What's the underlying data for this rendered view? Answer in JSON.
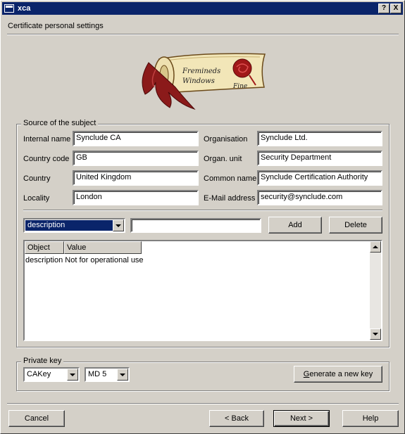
{
  "window": {
    "title": "xca"
  },
  "title_buttons": {
    "help": "?",
    "close": "X"
  },
  "page": {
    "subtitle": "Certificate personal settings"
  },
  "logo": {
    "line1": "Fremineds",
    "line2": "Windows",
    "line3": "Fine"
  },
  "subject": {
    "legend": "Source of the subject",
    "internal_name": {
      "label": "Internal name",
      "value": "Synclude CA"
    },
    "country_code": {
      "label": "Country code",
      "value": "GB"
    },
    "country": {
      "label": "Country",
      "value": "United Kingdom"
    },
    "locality": {
      "label": "Locality",
      "value": "London"
    },
    "organisation": {
      "label": "Organisation",
      "value": "Synclude Ltd."
    },
    "organ_unit": {
      "label": "Organ. unit",
      "value": "Security Department"
    },
    "common_name": {
      "label": "Common name",
      "value": "Synclude Certification Authority"
    },
    "email": {
      "label": "E-Mail address",
      "value": "security@synclude.com"
    }
  },
  "attr": {
    "selected": "description",
    "value": "",
    "add": "Add",
    "delete": "Delete"
  },
  "table": {
    "columns": [
      "Object",
      "Value"
    ],
    "rows": [
      {
        "object": "description",
        "value": "Not for operational use"
      }
    ]
  },
  "private_key": {
    "legend": "Private key",
    "key": "CAKey",
    "hash": "MD 5",
    "generate_prefix": "G",
    "generate_rest": "enerate a new key"
  },
  "footer": {
    "cancel": "Cancel",
    "back": "< Back",
    "next": "Next >",
    "help": "Help"
  }
}
